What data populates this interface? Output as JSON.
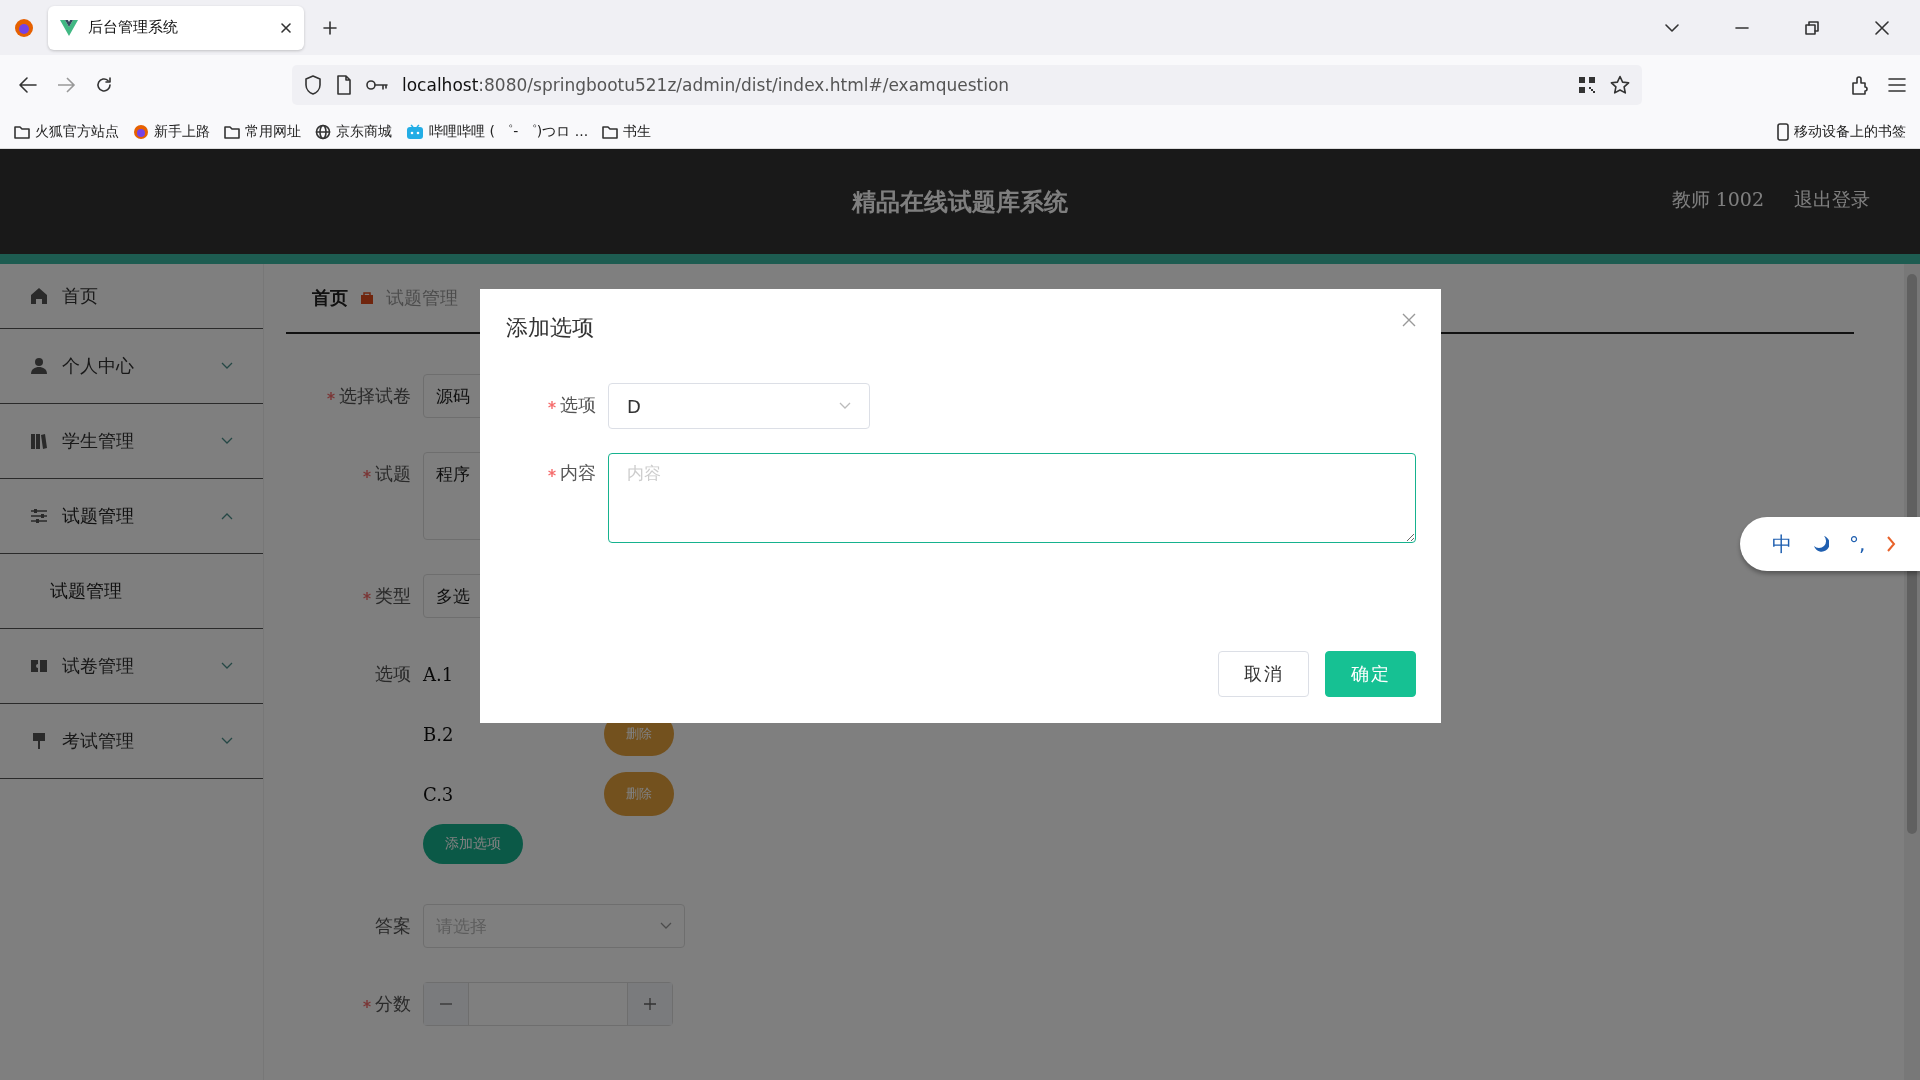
{
  "browser": {
    "tabs": [
      {
        "title": "后台管理系统",
        "selected": true
      }
    ],
    "address": {
      "host": "localhost",
      "path": ":8080/springbootu521z/admin/dist/index.html#/examquestion"
    },
    "bookmarks": [
      {
        "kind": "folder",
        "label": "火狐官方站点"
      },
      {
        "kind": "firefox",
        "label": "新手上路"
      },
      {
        "kind": "folder",
        "label": "常用网址"
      },
      {
        "kind": "globe",
        "label": "京东商城"
      },
      {
        "kind": "tv",
        "label": "哔哩哔哩 ( ゜- ゜)つロ ..."
      },
      {
        "kind": "folder",
        "label": "书生"
      }
    ],
    "mobile_bookmarks": "移动设备上的书签"
  },
  "header": {
    "title": "精品在线试题库系统",
    "user": "教师 1002",
    "logout": "退出登录"
  },
  "sidebar": {
    "items": [
      {
        "label": "首页"
      },
      {
        "label": "个人中心",
        "expanded": false
      },
      {
        "label": "学生管理",
        "expanded": false
      },
      {
        "label": "试题管理",
        "expanded": true,
        "children": [
          {
            "label": "试题管理"
          }
        ]
      },
      {
        "label": "试卷管理",
        "expanded": false
      },
      {
        "label": "考试管理",
        "expanded": false
      }
    ]
  },
  "breadcrumb": [
    "首页",
    "试题管理"
  ],
  "form": {
    "fields": [
      {
        "kind": "select",
        "label": "选择试卷",
        "required": true,
        "value": "源码"
      },
      {
        "kind": "textarea",
        "label": "试题",
        "required": true,
        "value": "程序"
      },
      {
        "kind": "select",
        "label": "类型",
        "required": true,
        "value": "多选"
      },
      {
        "kind": "options",
        "label": "选项",
        "required": false,
        "items": [
          {
            "text": "A.1"
          },
          {
            "text": "B.2",
            "button": "删除"
          },
          {
            "text": "C.3",
            "button": "删除"
          }
        ],
        "add_button": "添加选项"
      },
      {
        "kind": "select",
        "label": "答案",
        "required": false,
        "placeholder": "请选择"
      },
      {
        "kind": "number",
        "label": "分数",
        "required": true
      }
    ]
  },
  "dialog": {
    "title": "添加选项",
    "fields": [
      {
        "kind": "select",
        "label": "选项",
        "required": true,
        "value": "D"
      },
      {
        "kind": "textarea",
        "label": "内容",
        "required": true,
        "placeholder": "内容",
        "focused": true
      }
    ],
    "buttons": [
      {
        "label": "取消",
        "primary": false
      },
      {
        "label": "确定",
        "primary": true
      }
    ]
  },
  "ime": {
    "items": [
      {
        "kind": "text",
        "text": "中"
      },
      {
        "kind": "moon"
      },
      {
        "kind": "text",
        "text": "°,"
      },
      {
        "kind": "chevron"
      }
    ]
  }
}
